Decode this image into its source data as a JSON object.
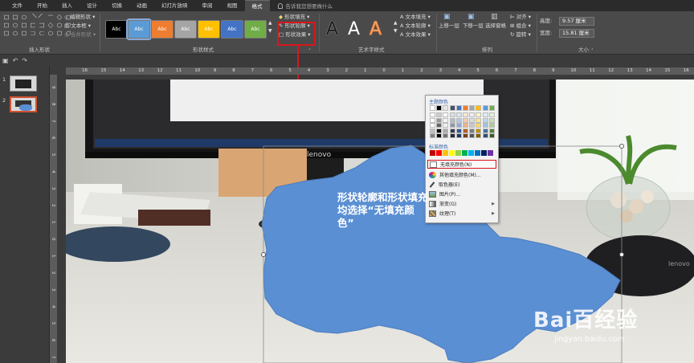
{
  "menu": {
    "items": [
      "文件",
      "开始",
      "插入",
      "设计",
      "切换",
      "动画",
      "幻灯片放映",
      "审阅",
      "视图",
      "格式"
    ],
    "tell_me": "告诉我您想要做什么"
  },
  "ribbon": {
    "insert_shapes": {
      "edit_shape": "编辑形状",
      "text_box": "文本框",
      "merge_shapes": "合并形状",
      "label": "插入形状"
    },
    "shape_styles": {
      "swatch_text": "Abc",
      "swatch_colors": [
        "#000000",
        "#5b9bd5",
        "#ed7d31",
        "#a5a5a5",
        "#ffc000",
        "#4472c4",
        "#70ad47"
      ],
      "fill": "形状填充",
      "outline": "形状轮廓",
      "effects": "形状效果",
      "label": "形状样式"
    },
    "wordart": {
      "glyph": "A",
      "text_fill": "文本填充",
      "text_outline": "文本轮廓",
      "text_effects": "文本效果",
      "label": "艺术字样式"
    },
    "arrange": {
      "bring_forward": "上移一层",
      "send_backward": "下移一层",
      "selection_pane": "选择窗格",
      "align": "对齐",
      "group": "组合",
      "rotate": "旋转",
      "label": "排列"
    },
    "size": {
      "height_label": "高度:",
      "height_value": "9.57 厘米",
      "width_label": "宽度:",
      "width_value": "15.81 厘米",
      "label": "大小"
    }
  },
  "thumbnails": {
    "numbers": [
      "1",
      "2"
    ],
    "selected": 2
  },
  "ruler": {
    "h_numbers": [
      "16",
      "15",
      "14",
      "13",
      "12",
      "11",
      "10",
      "9",
      "8",
      "7",
      "6",
      "5",
      "4",
      "3",
      "2",
      "1",
      "0",
      "1",
      "2",
      "3",
      "4",
      "5",
      "6",
      "7",
      "8",
      "9",
      "10",
      "11",
      "12",
      "13",
      "14",
      "15",
      "16"
    ],
    "v_numbers": [
      "9",
      "8",
      "7",
      "6",
      "5",
      "4",
      "3",
      "2",
      "1",
      "0",
      "1",
      "2",
      "3",
      "4",
      "5",
      "6",
      "7"
    ]
  },
  "slide_photo": {
    "monitor_brand": "lenovo",
    "mouse_brand": "lenovo"
  },
  "color_menu": {
    "theme_colors_label": "主题颜色",
    "standard_colors_label": "标准颜色",
    "theme_palette": [
      "#ffffff",
      "#000000",
      "#e7e6e6",
      "#44546a",
      "#4472c4",
      "#ed7d31",
      "#a5a5a5",
      "#ffc000",
      "#5b9bd5",
      "#70ad47"
    ],
    "standard_palette": [
      "#c00000",
      "#ff0000",
      "#ffc000",
      "#ffff00",
      "#92d050",
      "#00b050",
      "#00b0f0",
      "#0070c0",
      "#002060",
      "#7030a0"
    ],
    "items": [
      {
        "label": "无填充颜色(N)",
        "icon": "no-fill-icon",
        "submenu": false
      },
      {
        "label": "其他填充颜色(M)...",
        "icon": "color-wheel-icon",
        "submenu": false
      },
      {
        "label": "取色器(E)",
        "icon": "eyedropper-icon",
        "submenu": false
      },
      {
        "label": "图片(P)...",
        "icon": "picture-icon",
        "submenu": false
      },
      {
        "label": "渐变(G)",
        "icon": "gradient-icon",
        "submenu": true
      },
      {
        "label": "纹理(T)",
        "icon": "texture-icon",
        "submenu": true
      }
    ],
    "highlighted": 0
  },
  "annotation": "形状轮廓和形状填充均选择“无填充颜色”",
  "watermark": {
    "brand": "Bai百经验",
    "url": "jingyan.baidu.com"
  },
  "colors": {
    "accent_red": "#d8161c",
    "shape_blue": "#5b8fd3",
    "ribbon_bg": "#4a4a4a"
  }
}
